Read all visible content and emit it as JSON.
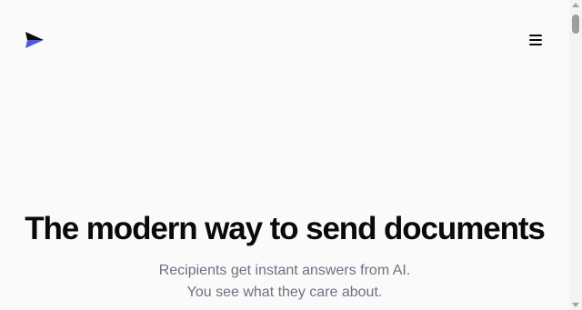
{
  "header": {
    "logo_icon": "paper-plane-icon",
    "menu_icon": "hamburger-menu-icon"
  },
  "hero": {
    "title": "The modern way to send documents",
    "subtitle_line1": "Recipients get instant answers from AI.",
    "subtitle_line2": "You see what they care about."
  },
  "colors": {
    "logo_dark": "#0a0a0a",
    "logo_accent": "#4f5bd5",
    "background": "#fafafa",
    "subtitle": "#6b7280"
  }
}
